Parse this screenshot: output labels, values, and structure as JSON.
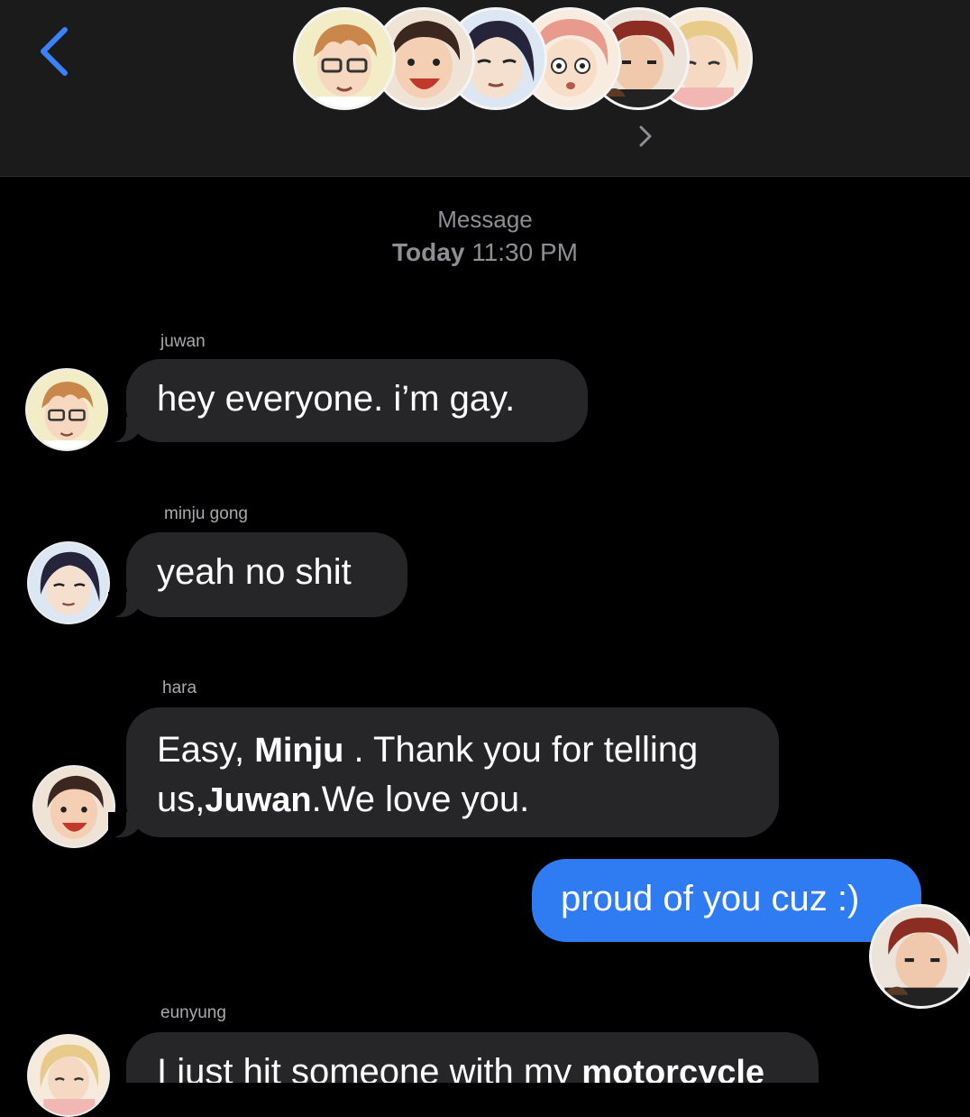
{
  "header": {
    "back_icon": "chevron-left-icon",
    "accent_color": "#3a82f7",
    "group_avatars": [
      "juwan",
      "hara",
      "minju gong",
      "yoonmi",
      "duk-gu",
      "eunyung"
    ]
  },
  "thread": {
    "label": "Message",
    "time_day": "Today",
    "time_clock": "11:30 PM"
  },
  "messages": [
    {
      "sender": "juwan",
      "text": "hey everyone. i’m gay."
    },
    {
      "sender": "minju gong",
      "text": "yeah no shit"
    },
    {
      "sender": "hara",
      "line1_a": "Easy, ",
      "line1_name": "Minju",
      "line1_b": " . Thank you for telling",
      "line2_a": "us,",
      "line2_name": "Juwan",
      "line2_b": ".We love you."
    },
    {
      "text": "proud of you cuz :)"
    },
    {
      "sender": "eunyung",
      "text_a": "I just hit someone with my ",
      "text_name": "motorcycle"
    }
  ],
  "colors": {
    "incoming_bubble": "#262628",
    "outgoing_bubble": "#2f7bf2",
    "background": "#000000",
    "header_bg": "#1b1b1b"
  }
}
